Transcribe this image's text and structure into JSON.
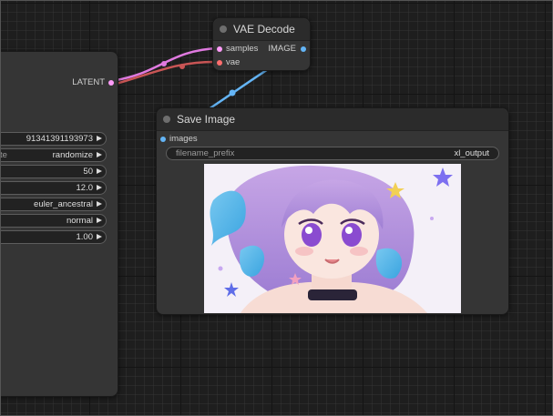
{
  "sampler_node": {
    "output_label": "LATENT",
    "widgets": [
      {
        "label": "",
        "value": "91341391193973"
      },
      {
        "label": "te",
        "value": "randomize"
      },
      {
        "label": "",
        "value": "50"
      },
      {
        "label": "",
        "value": "12.0"
      },
      {
        "label": "",
        "value": "euler_ancestral"
      },
      {
        "label": "",
        "value": "normal"
      },
      {
        "label": "",
        "value": "1.00"
      }
    ]
  },
  "vae_decode_node": {
    "title": "VAE Decode",
    "inputs": [
      "samples",
      "vae"
    ],
    "output_label": "IMAGE"
  },
  "save_image_node": {
    "title": "Save Image",
    "input_label": "images",
    "filename_prefix_label": "filename_prefix",
    "filename_prefix_value": "xl_output"
  },
  "colors": {
    "latent": "#ff9cf9",
    "vae": "#ff6e6e",
    "image": "#64b5f6",
    "canvas": "#1e1e1e",
    "node": "#353535"
  },
  "icons": [
    "arrow-right-icon",
    "node-status-dot-icon"
  ]
}
